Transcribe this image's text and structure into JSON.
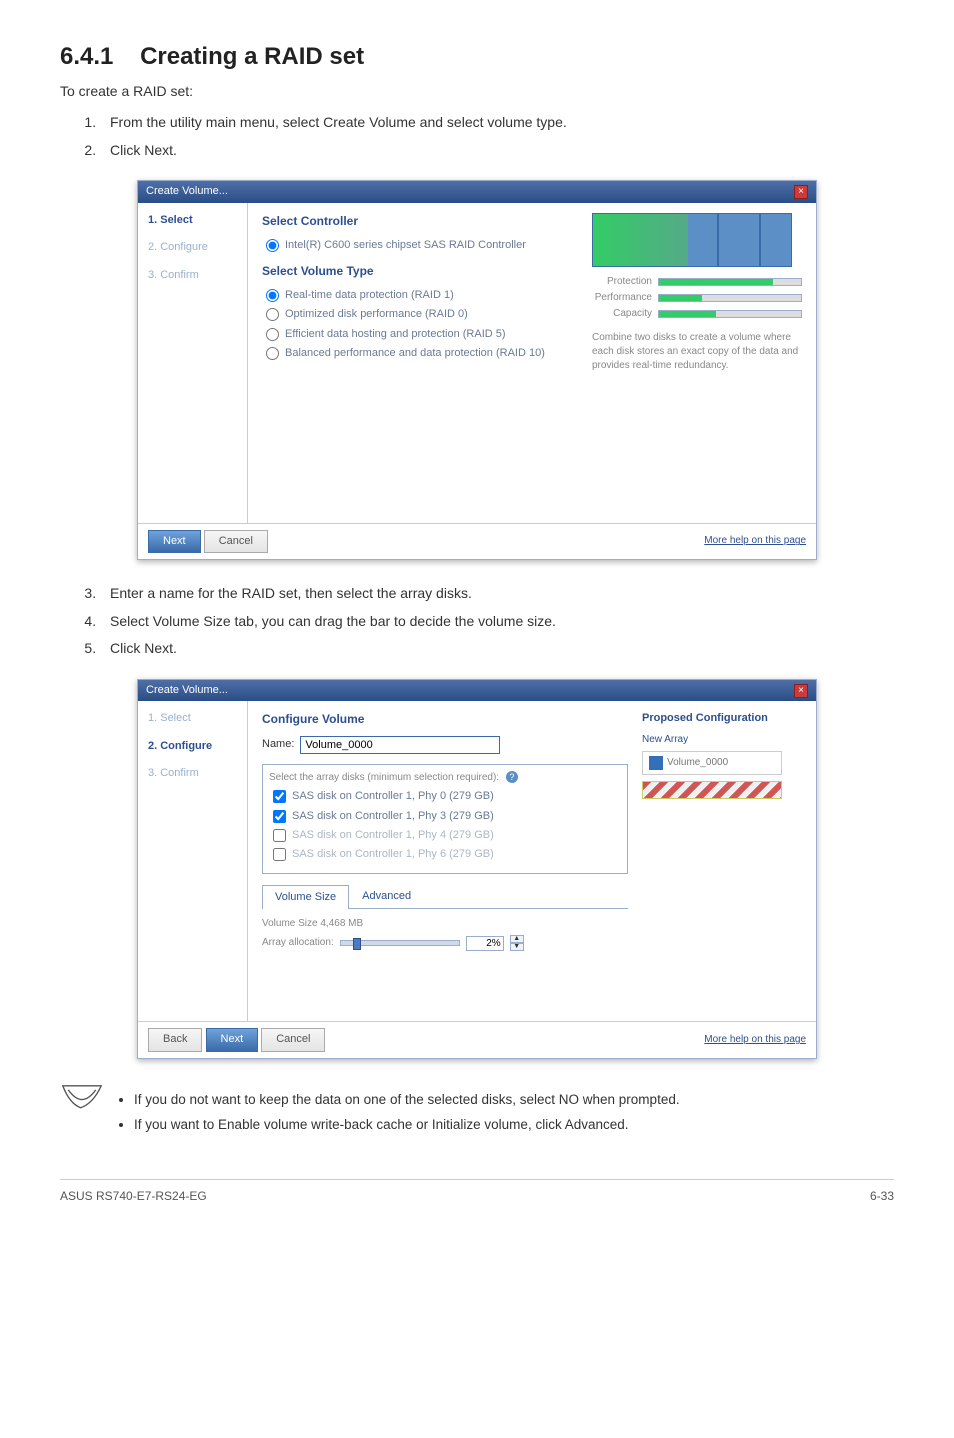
{
  "heading": {
    "number": "6.4.1",
    "title": "Creating a RAID set"
  },
  "intro": "To create a RAID set:",
  "steps_top": [
    "From the utility main menu, select Create Volume and select volume type.",
    "Click Next."
  ],
  "dialog1": {
    "title": "Create Volume...",
    "sidebar": [
      "1. Select",
      "2. Configure",
      "3. Confirm"
    ],
    "heading1": "Select Controller",
    "controller_radio": "Intel(R) C600 series chipset SAS RAID Controller",
    "heading2": "Select Volume Type",
    "vol_types": [
      "Real-time data protection (RAID 1)",
      "Optimized disk performance (RAID 0)",
      "Efficient data hosting and protection (RAID 5)",
      "Balanced performance and data protection (RAID 10)"
    ],
    "meters": [
      {
        "label": "Protection",
        "pct": 80
      },
      {
        "label": "Performance",
        "pct": 30
      },
      {
        "label": "Capacity",
        "pct": 40
      }
    ],
    "desc": "Combine two disks to create a volume where each disk stores an exact copy of the data and provides real-time redundancy.",
    "footer_next": "Next",
    "footer_cancel": "Cancel",
    "footer_help": "More help on this page"
  },
  "steps_mid": [
    "Enter a name for the RAID set, then select the array disks.",
    "Select Volume Size tab, you can drag the bar to decide the volume size.",
    "Click Next."
  ],
  "dialog2": {
    "title": "Create Volume...",
    "sidebar": [
      "1. Select",
      "2. Configure",
      "3. Confirm"
    ],
    "heading": "Configure Volume",
    "name_label": "Name:",
    "name_value": "Volume_0000",
    "disk_instr": "Select the array disks (minimum selection required):",
    "disks": [
      {
        "checked": true,
        "label": "SAS disk on Controller 1, Phy 0 (279 GB)"
      },
      {
        "checked": true,
        "label": "SAS disk on Controller 1, Phy 3 (279 GB)"
      },
      {
        "checked": false,
        "label": "SAS disk on Controller 1, Phy 4 (279 GB)"
      },
      {
        "checked": false,
        "label": "SAS disk on Controller 1, Phy 6 (279 GB)"
      }
    ],
    "tabs": [
      "Volume Size",
      "Advanced"
    ],
    "vol_size_label": "Volume Size 4,468 MB",
    "alloc_label": "Array allocation:",
    "alloc_pct": "2%",
    "prop_title": "Proposed Configuration",
    "new_array": "New Array",
    "vol_badge": "Volume_0000",
    "footer_back": "Back",
    "footer_next": "Next",
    "footer_cancel": "Cancel",
    "footer_help": "More help on this page"
  },
  "notes": [
    "If you do not want to keep the data on one of the selected disks, select NO when prompted.",
    "If you want to Enable volume write-back cache or Initialize volume, click Advanced."
  ],
  "footer": {
    "left": "ASUS RS740-E7-RS24-EG",
    "right": "6-33"
  }
}
